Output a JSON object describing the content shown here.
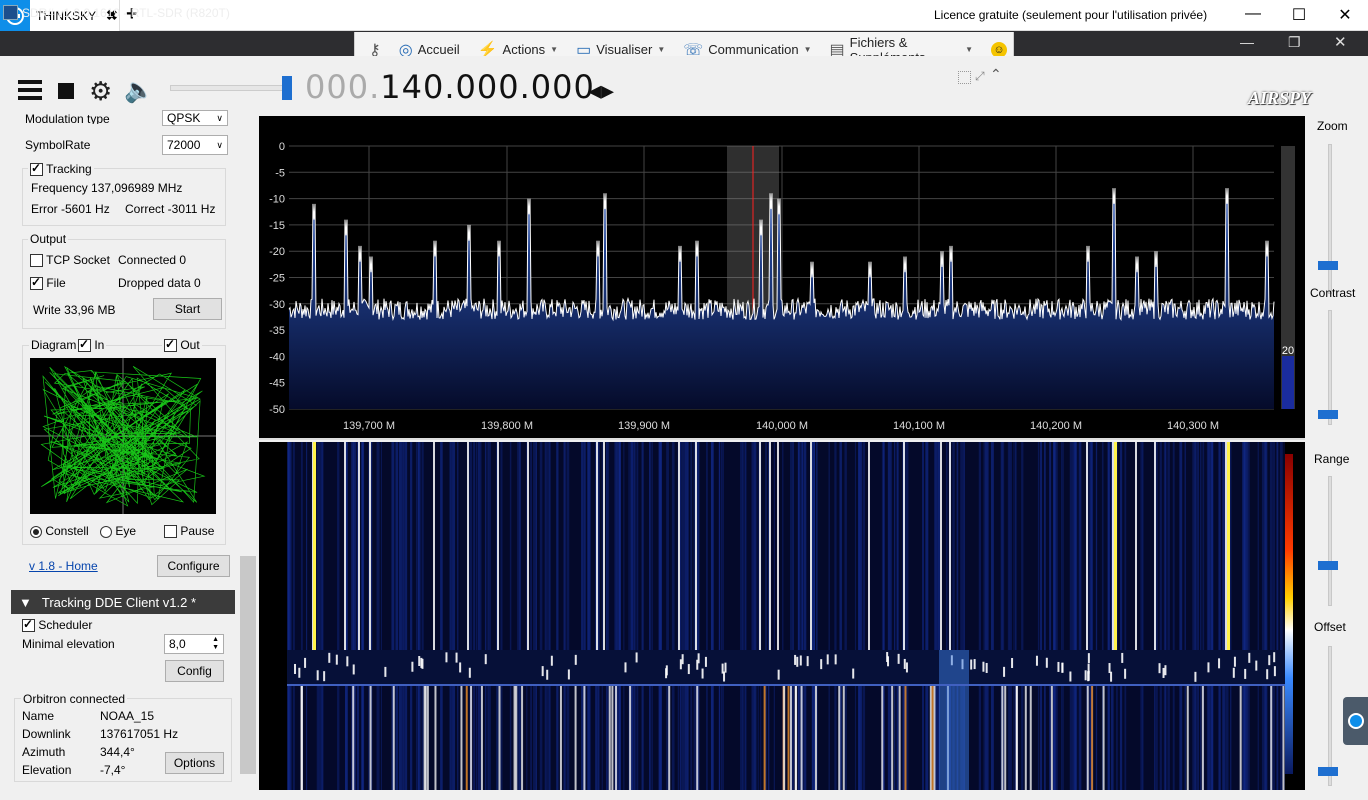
{
  "teamviewer": {
    "tab_label": "THINKSKY",
    "close_tab": "✖",
    "new_tab": "+",
    "licence": "Licence gratuite (seulement pour l'utilisation privée)",
    "minimize": "—",
    "maximize": "☐",
    "close": "✕"
  },
  "window": {
    "title": "SDR# v1.0.0.1619 - RTL-SDR (R820T)",
    "minimize": "—",
    "restore": "❐",
    "close": "✕"
  },
  "menu": {
    "home": "Accueil",
    "actions": "Actions",
    "view": "Visualiser",
    "communication": "Communication",
    "files": "Fichiers & Suppléments"
  },
  "frequency": {
    "dim": "000.",
    "value": "140.000.000",
    "arrows": "◂▸"
  },
  "brand": "AIRSPY",
  "left": {
    "modulation_label": "Modulation type",
    "modulation_value": "QPSK",
    "symbolrate_label": "SymbolRate",
    "symbolrate_value": "72000",
    "tracking_label": "Tracking",
    "frequency_text": "Frequency 137,096989 MHz",
    "error_text": "Error -5601 Hz",
    "correct_text": "Correct -3011 Hz",
    "output_label": "Output",
    "tcp_label": "TCP Socket",
    "tcp_status": "Connected 0",
    "file_label": "File",
    "dropped_text": "Dropped data 0",
    "write_text": "Write 33,96 MB",
    "start_button": "Start",
    "diagram_label": "Diagram",
    "in_label": "In",
    "out_label": "Out",
    "constell_label": "Constell",
    "eye_label": "Eye",
    "pause_label": "Pause",
    "home_link": "v 1.8 - Home",
    "configure_button": "Configure",
    "section_title": "Tracking DDE Client v1.2 *",
    "scheduler_label": "Scheduler",
    "min_elev_label": "Minimal elevation",
    "min_elev_value": "8,0",
    "config_button": "Config",
    "orbitron_label": "Orbitron connected",
    "name_label": "Name",
    "name_value": "NOAA_15",
    "downlink_label": "Downlink",
    "downlink_value": "137617051 Hz",
    "azimuth_label": "Azimuth",
    "azimuth_value": "344,4°",
    "elevation_label": "Elevation",
    "elevation_value": "-7,4°",
    "options_button": "Options"
  },
  "right": {
    "zoom": "Zoom",
    "contrast": "Contrast",
    "range": "Range",
    "offset": "Offset"
  },
  "spectrum": {
    "y_ticks": [
      "0",
      "-5",
      "-10",
      "-15",
      "-20",
      "-25",
      "-30",
      "-35",
      "-40",
      "-45",
      "-50"
    ],
    "x_ticks": [
      "139,700 M",
      "139,800 M",
      "139,900 M",
      "140,000 M",
      "140,100 M",
      "140,200 M",
      "140,300 M"
    ],
    "gauge_label": "20",
    "colors": {
      "trace": "#ffffff",
      "fill": "#1c3a8a",
      "marker": "#ff2020"
    }
  }
}
